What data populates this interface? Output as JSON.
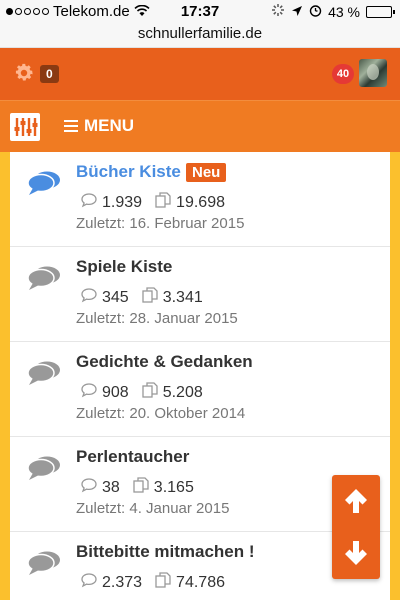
{
  "status_bar": {
    "carrier": "Telekom.de",
    "time": "17:37",
    "battery_percent_label": "43 %",
    "battery_level": 0.43
  },
  "browser": {
    "url": "schnullerfamilie.de"
  },
  "header": {
    "settings_count": "0",
    "notification_count": "40"
  },
  "menubar": {
    "menu_label": "MENU"
  },
  "forums": [
    {
      "title": "Bücher Kiste",
      "badge": "Neu",
      "replies": "1.939",
      "posts": "19.698",
      "last": "Zuletzt: 16. Februar 2015",
      "unread": true
    },
    {
      "title": "Spiele Kiste",
      "replies": "345",
      "posts": "3.341",
      "last": "Zuletzt: 28. Januar 2015",
      "unread": false
    },
    {
      "title": "Gedichte & Gedanken",
      "replies": "908",
      "posts": "5.208",
      "last": "Zuletzt: 20. Oktober 2014",
      "unread": false
    },
    {
      "title": "Perlentaucher",
      "replies": "38",
      "posts": "3.165",
      "last": "Zuletzt: 4. Januar 2015",
      "unread": false
    },
    {
      "title": "Bittebitte mitmachen !",
      "replies": "2.373",
      "posts": "74.786",
      "last": "",
      "unread": false
    }
  ],
  "colors": {
    "header_orange": "#e8601c",
    "menu_orange": "#f07b22",
    "accent_yellow": "#fbc02d",
    "link_blue": "#4a8de0"
  },
  "icons": {
    "settings": "gear-icon",
    "forum": "speech-bubbles-icon",
    "replies": "comment-icon",
    "posts": "pages-icon",
    "scroll_up": "arrow-up-icon",
    "scroll_down": "arrow-down-icon"
  }
}
